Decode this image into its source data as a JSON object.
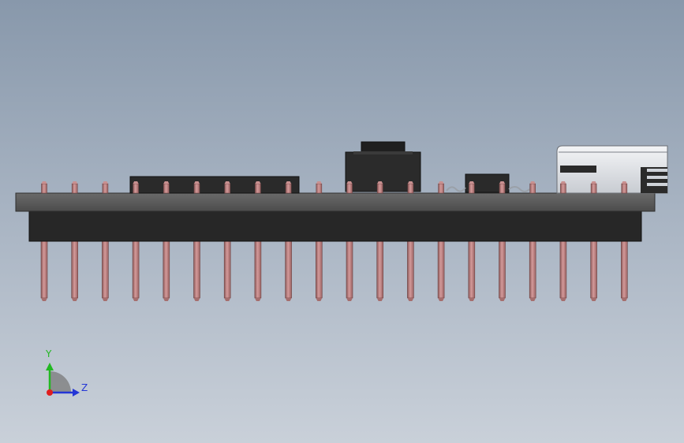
{
  "view": {
    "background_top": "#8898ab",
    "background_bottom": "#c9d0d9"
  },
  "model": {
    "pin_count": 20,
    "colors": {
      "board": "#5a5a5a",
      "header_body": "#272727",
      "pin": "#c48686",
      "component": "#2a2a2a",
      "connector_shell": "#e6e8ec"
    }
  },
  "triad": {
    "y_label": "Y",
    "z_label": "Z",
    "y_color": "#22b822",
    "z_color": "#2436d6",
    "x_color": "#e01e1e"
  }
}
